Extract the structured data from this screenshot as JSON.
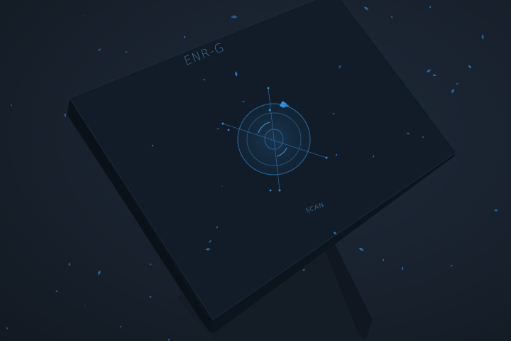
{
  "device": {
    "brand": "ENR-G",
    "scan_label": "SCAN",
    "icon": "radar-target-icon"
  },
  "colors": {
    "background": "#1a2431",
    "device_face": "#111d29",
    "device_edge": "#0d1620",
    "accent": "#3a8fd6",
    "particle": "#2f86d8"
  }
}
